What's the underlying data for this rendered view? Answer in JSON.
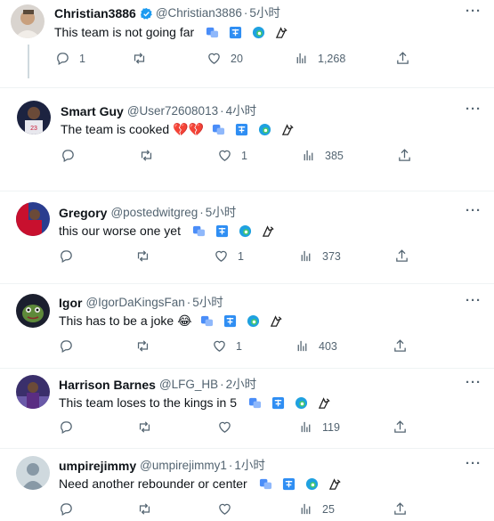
{
  "colors": {
    "verified": "#1d9bf0",
    "icon_gray": "#536471",
    "divider": "#eff3f4",
    "thread_line": "#cfd9de"
  },
  "icons": {
    "more": "more-horizontal-icon",
    "reply": "reply-icon",
    "retweet": "retweet-icon",
    "like": "heart-icon",
    "views": "views-chart-icon",
    "share": "share-icon",
    "extensions": [
      "translate-extension-icon",
      "translate-badge-icon",
      "edge-extension-icon",
      "feedback-extension-icon"
    ]
  },
  "more_label": "···",
  "tweets": [
    {
      "name": "Christian3886",
      "verified": true,
      "handle": "@Christian3886",
      "time": "5小时",
      "text": "This team is not going far",
      "emoji": "",
      "replies": "1",
      "retweets": "",
      "likes": "20",
      "views": "1,268"
    },
    {
      "name": "Smart Guy",
      "verified": false,
      "handle": "@User72608013",
      "time": "4小时",
      "text": "The team is cooked",
      "emoji": "💔💔",
      "replies": "",
      "retweets": "",
      "likes": "1",
      "views": "385"
    },
    {
      "name": "Gregory",
      "verified": false,
      "handle": "@postedwitgreg",
      "time": "5小时",
      "text": "this our worse one yet",
      "emoji": "",
      "replies": "",
      "retweets": "",
      "likes": "1",
      "views": "373"
    },
    {
      "name": "Igor",
      "verified": false,
      "handle": "@IgorDaKingsFan",
      "time": "5小时",
      "text": "This has to be a joke",
      "emoji": "😂",
      "replies": "",
      "retweets": "",
      "likes": "1",
      "views": "403"
    },
    {
      "name": "Harrison Barnes",
      "verified": false,
      "handle": "@LFG_HB",
      "time": "2小时",
      "text": "This team loses to the kings in 5",
      "emoji": "",
      "replies": "",
      "retweets": "",
      "likes": "",
      "views": "119"
    },
    {
      "name": "umpirejimmy",
      "verified": false,
      "handle": "@umpirejimmy1",
      "time": "1小时",
      "text": "Need another rebounder or center",
      "emoji": "",
      "replies": "",
      "retweets": "",
      "likes": "",
      "views": "25"
    }
  ]
}
